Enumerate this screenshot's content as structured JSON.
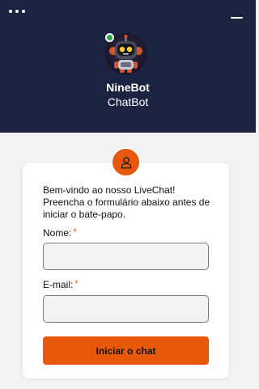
{
  "header": {
    "bot_name": "NineBot",
    "bot_role": "ChatBot",
    "status": "online",
    "menu_icon": "more-horizontal-icon",
    "minimize_icon": "minimize-icon"
  },
  "form": {
    "welcome_text": "Bem-vindo ao nosso LiveChat! Preencha o formulário abaixo antes de iniciar o bate-papo.",
    "name_label": "Nome:",
    "email_label": "E-mail:",
    "required_mark": "*",
    "name_value": "",
    "email_value": "",
    "submit_label": "Iniciar o chat",
    "badge_icon": "user-icon"
  },
  "colors": {
    "header_bg": "#1b2340",
    "accent": "#e8580a",
    "status_online": "#2fa24d",
    "page_bg": "#f2f2f3"
  }
}
